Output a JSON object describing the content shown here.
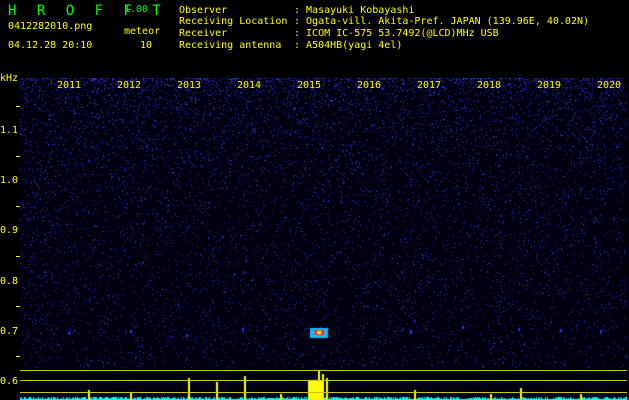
{
  "app": {
    "title": "H R O F F T",
    "version": "1.00",
    "filename": "0412282010.png",
    "datetime": "04.12.28 20:10",
    "meteor_label": "meteor",
    "meteor_count": "10"
  },
  "info": {
    "observer_label": "Observer",
    "observer_value": ": Masayuki Kobayashi",
    "location_label": "Receiving Location",
    "location_value": ": Ogata-vill. Akita-Pref. JAPAN (139.96E, 40.02N)",
    "receiver_label": "Receiver",
    "receiver_value": ": ICOM IC-575 53.7492(@LCD)MHz USB",
    "antenna_label": "Receiving antenna",
    "antenna_value": ": A504HB(yagi 4el)"
  },
  "axis": {
    "unit": "kHz",
    "x_labels": [
      "2011",
      "2012",
      "2013",
      "2014",
      "2015",
      "2016",
      "2017",
      "2018",
      "2019",
      "2020"
    ],
    "y_labels": [
      "1.1",
      "1.0",
      "0.9",
      "0.8",
      "0.7",
      "0.6"
    ]
  },
  "colors": {
    "header_text": "#ffff00",
    "title_text": "#00ff00",
    "noise_blue": "#3030ff",
    "baseline_cyan": "#00ffff",
    "echo_red": "#ff3030",
    "echo_yellow": "#ffff00"
  }
}
